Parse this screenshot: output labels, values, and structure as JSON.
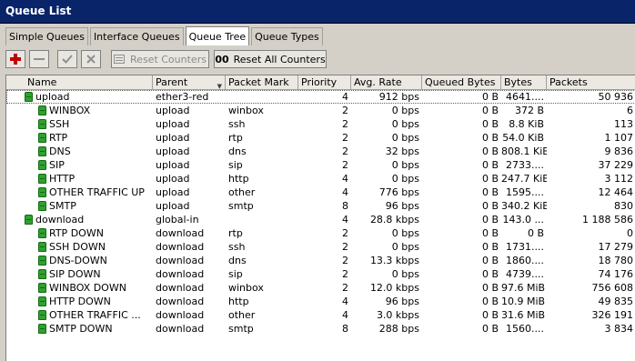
{
  "window": {
    "title": "Queue List"
  },
  "tabs": [
    {
      "label": "Simple Queues",
      "active": false
    },
    {
      "label": "Interface Queues",
      "active": false
    },
    {
      "label": "Queue Tree",
      "active": true
    },
    {
      "label": "Queue Types",
      "active": false
    }
  ],
  "toolbar": {
    "add_icon": "plus-icon",
    "remove_icon": "minus-icon",
    "enable_icon": "check-icon",
    "disable_icon": "x-icon",
    "reset_counters": "Reset Counters",
    "reset_all_counters": "Reset All Counters",
    "reset_all_badge": "00"
  },
  "colors": {
    "titlebar": "#0a246a",
    "queue_icon": "#2fa12f"
  },
  "table": {
    "columns": [
      "Name",
      "Parent",
      "Packet Mark",
      "Priority",
      "Avg. Rate",
      "Queued Bytes",
      "Bytes",
      "Packets"
    ],
    "rows": [
      {
        "indent": 1,
        "name": "upload",
        "parent": "ether3-red",
        "mark": "",
        "priority": "4",
        "rate": "912 bps",
        "queued": "0 B",
        "bytes": "4641....",
        "packets": "50 936",
        "selected": true
      },
      {
        "indent": 2,
        "name": "WINBOX",
        "parent": "upload",
        "mark": "winbox",
        "priority": "2",
        "rate": "0 bps",
        "queued": "0 B",
        "bytes": "372 B",
        "packets": "6"
      },
      {
        "indent": 2,
        "name": "SSH",
        "parent": "upload",
        "mark": "ssh",
        "priority": "2",
        "rate": "0 bps",
        "queued": "0 B",
        "bytes": "8.8 KiB",
        "packets": "113"
      },
      {
        "indent": 2,
        "name": "RTP",
        "parent": "upload",
        "mark": "rtp",
        "priority": "2",
        "rate": "0 bps",
        "queued": "0 B",
        "bytes": "54.0 KiB",
        "packets": "1 107"
      },
      {
        "indent": 2,
        "name": "DNS",
        "parent": "upload",
        "mark": "dns",
        "priority": "2",
        "rate": "32 bps",
        "queued": "0 B",
        "bytes": "808.1 KiB",
        "packets": "9 836"
      },
      {
        "indent": 2,
        "name": "SIP",
        "parent": "upload",
        "mark": "sip",
        "priority": "2",
        "rate": "0 bps",
        "queued": "0 B",
        "bytes": "2733....",
        "packets": "37 229"
      },
      {
        "indent": 2,
        "name": "HTTP",
        "parent": "upload",
        "mark": "http",
        "priority": "4",
        "rate": "0 bps",
        "queued": "0 B",
        "bytes": "247.7 KiB",
        "packets": "3 112"
      },
      {
        "indent": 2,
        "name": "OTHER TRAFFIC UP",
        "parent": "upload",
        "mark": "other",
        "priority": "4",
        "rate": "776 bps",
        "queued": "0 B",
        "bytes": "1595....",
        "packets": "12 464"
      },
      {
        "indent": 2,
        "name": "SMTP",
        "parent": "upload",
        "mark": "smtp",
        "priority": "8",
        "rate": "96 bps",
        "queued": "0 B",
        "bytes": "340.2 KiB",
        "packets": "830"
      },
      {
        "indent": 1,
        "name": "download",
        "parent": "global-in",
        "mark": "",
        "priority": "4",
        "rate": "28.8 kbps",
        "queued": "0 B",
        "bytes": "143.0 ...",
        "packets": "1 188 586"
      },
      {
        "indent": 2,
        "name": "RTP DOWN",
        "parent": "download",
        "mark": "rtp",
        "priority": "2",
        "rate": "0 bps",
        "queued": "0 B",
        "bytes": "0 B",
        "packets": "0"
      },
      {
        "indent": 2,
        "name": "SSH DOWN",
        "parent": "download",
        "mark": "ssh",
        "priority": "2",
        "rate": "0 bps",
        "queued": "0 B",
        "bytes": "1731....",
        "packets": "17 279"
      },
      {
        "indent": 2,
        "name": "DNS-DOWN",
        "parent": "download",
        "mark": "dns",
        "priority": "2",
        "rate": "13.3 kbps",
        "queued": "0 B",
        "bytes": "1860....",
        "packets": "18 780"
      },
      {
        "indent": 2,
        "name": "SIP DOWN",
        "parent": "download",
        "mark": "sip",
        "priority": "2",
        "rate": "0 bps",
        "queued": "0 B",
        "bytes": "4739....",
        "packets": "74 176"
      },
      {
        "indent": 2,
        "name": "WINBOX DOWN",
        "parent": "download",
        "mark": "winbox",
        "priority": "2",
        "rate": "12.0 kbps",
        "queued": "0 B",
        "bytes": "97.6 MiB",
        "packets": "756 608"
      },
      {
        "indent": 2,
        "name": "HTTP DOWN",
        "parent": "download",
        "mark": "http",
        "priority": "4",
        "rate": "96 bps",
        "queued": "0 B",
        "bytes": "10.9 MiB",
        "packets": "49 835"
      },
      {
        "indent": 2,
        "name": "OTHER TRAFFIC ...",
        "parent": "download",
        "mark": "other",
        "priority": "4",
        "rate": "3.0 kbps",
        "queued": "0 B",
        "bytes": "31.6 MiB",
        "packets": "326 191"
      },
      {
        "indent": 2,
        "name": "SMTP DOWN",
        "parent": "download",
        "mark": "smtp",
        "priority": "8",
        "rate": "288 bps",
        "queued": "0 B",
        "bytes": "1560....",
        "packets": "3 834"
      }
    ]
  }
}
